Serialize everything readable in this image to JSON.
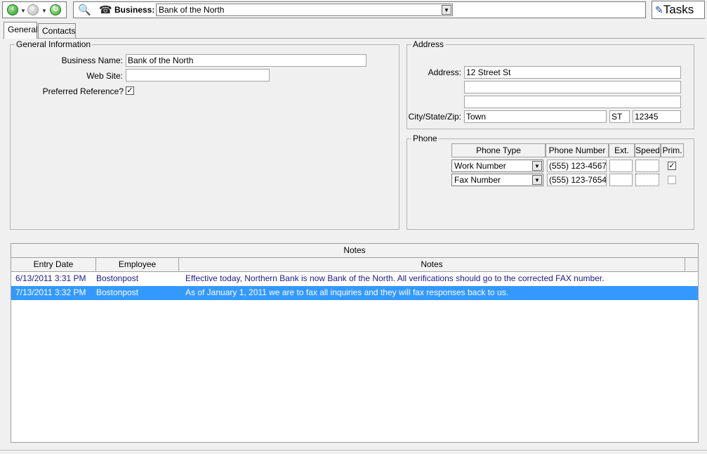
{
  "toolbar": {
    "business_label": "Business:",
    "business_value": "Bank of the North",
    "tasks_label": "Tasks"
  },
  "tabs": [
    {
      "label": "General"
    },
    {
      "label": "Contacts"
    }
  ],
  "general": {
    "legend": "General Information",
    "business_name_label": "Business Name:",
    "business_name_value": "Bank of the North",
    "web_site_label": "Web Site:",
    "web_site_value": "",
    "preferred_label": "Preferred Reference?",
    "preferred_checked": true
  },
  "address": {
    "legend": "Address",
    "address_label": "Address:",
    "line1": "12 Street St",
    "line2": "",
    "line3": "",
    "csz_label": "City/State/Zip:",
    "city": "Town",
    "state": "ST",
    "zip": "12345"
  },
  "phone": {
    "legend": "Phone",
    "headers": [
      "Phone Type",
      "Phone Number",
      "Ext.",
      "Speed",
      "Prim."
    ],
    "rows": [
      {
        "type": "Work Number",
        "number": "(555) 123-4567",
        "ext": "",
        "speed": "",
        "primary": true
      },
      {
        "type": "Fax Number",
        "number": "(555) 123-7654",
        "ext": "",
        "speed": "",
        "primary": false
      }
    ]
  },
  "notes": {
    "title": "Notes",
    "headers": [
      "Entry Date",
      "Employee",
      "Notes"
    ],
    "rows": [
      {
        "date": "6/13/2011 3:31 PM",
        "employee": "Bostonpost",
        "note": "Effective today, Northern Bank is now Bank of the North.  All verifications should go to the corrected FAX number.",
        "selected": false
      },
      {
        "date": "7/13/2011 3:32 PM",
        "employee": "Bostonpost",
        "note": "As of January 1, 2011 we are to fax all inquiries and they will fax responses back to us.",
        "selected": true
      }
    ]
  },
  "colors": {
    "selection": "#3399ff",
    "note_text": "#1b1b8c"
  }
}
